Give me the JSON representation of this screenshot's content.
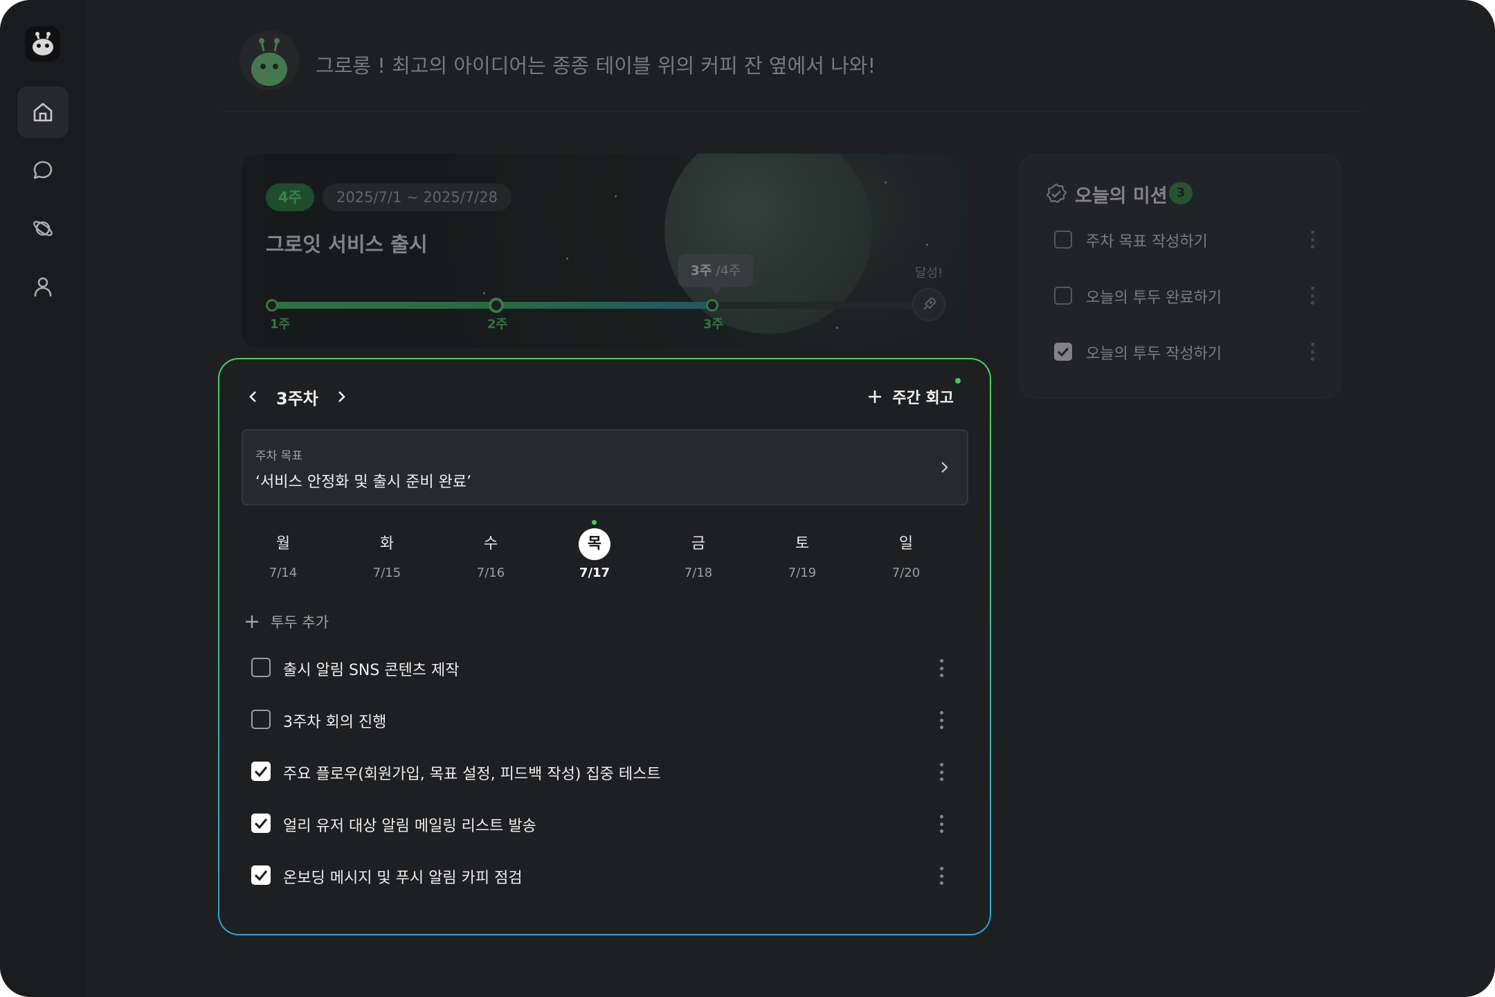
{
  "greeting": {
    "text": "그로롱 ! 최고의 아이디어는 종종 테이블 위의 커피 잔 옆에서 나와!"
  },
  "goal_card": {
    "week_chip": "4주",
    "date_range": "2025/7/1 ~ 2025/7/28",
    "title": "그로잇 서비스 출시",
    "tooltip_current": "3주",
    "tooltip_total": "/4주",
    "achieve_label": "달성!",
    "progress_fraction": 0.68,
    "weeks": [
      "1주",
      "2주",
      "3주"
    ]
  },
  "mission": {
    "title": "오늘의 미션",
    "count": "3",
    "items": [
      {
        "label": "주차 목표 작성하기",
        "checked": false
      },
      {
        "label": "오늘의 투두 완료하기",
        "checked": false
      },
      {
        "label": "오늘의 투두 작성하기",
        "checked": true
      }
    ]
  },
  "week_panel": {
    "title": "3주차",
    "review_label": "주간 회고",
    "goal_label": "주차 목표",
    "goal_text": "‘서비스 안정화 및 출시 준비 완료’",
    "days": [
      {
        "name": "월",
        "date": "7/14",
        "active": false
      },
      {
        "name": "화",
        "date": "7/15",
        "active": false
      },
      {
        "name": "수",
        "date": "7/16",
        "active": false
      },
      {
        "name": "목",
        "date": "7/17",
        "active": true
      },
      {
        "name": "금",
        "date": "7/18",
        "active": false
      },
      {
        "name": "토",
        "date": "7/19",
        "active": false
      },
      {
        "name": "일",
        "date": "7/20",
        "active": false
      }
    ],
    "add_todo_label": "투두 추가",
    "todos": [
      {
        "label": "출시 알림 SNS 콘텐츠 제작",
        "checked": false
      },
      {
        "label": "3주차 회의 진행",
        "checked": false
      },
      {
        "label": "주요 플로우(회원가입, 목표 설정, 피드백 작성) 집중 테스트",
        "checked": true
      },
      {
        "label": "얼리 유저 대상 알림 메일링 리스트 발송",
        "checked": true
      },
      {
        "label": "온보딩 메시지 및 푸시 알림 카피 점검",
        "checked": true
      }
    ]
  },
  "colors": {
    "accent": "#3ccf57",
    "panel_border_end": "#2da6d6"
  }
}
